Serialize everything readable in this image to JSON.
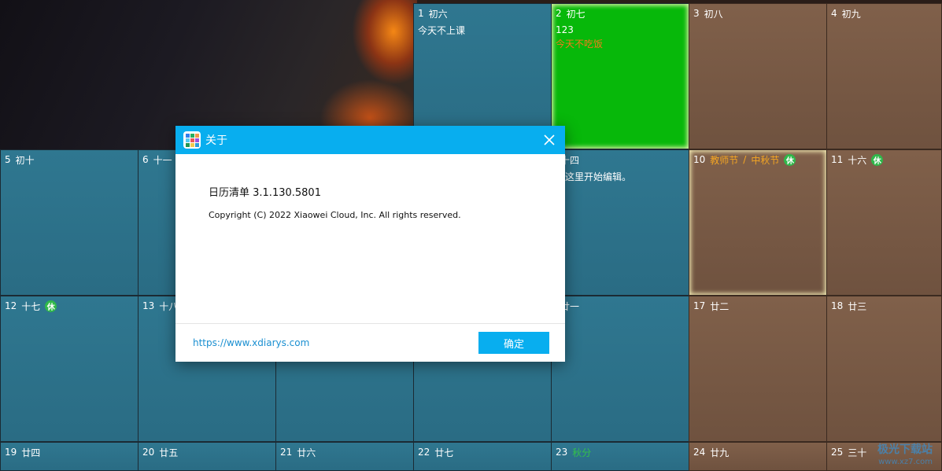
{
  "calendar": {
    "cells": [
      {
        "day": "1",
        "lunar": "初六",
        "note": "今天不上课",
        "style": "blue"
      },
      {
        "day": "2",
        "lunar": "初七",
        "note": "123",
        "note2": "今天不吃饭",
        "style": "green"
      },
      {
        "day": "3",
        "lunar": "初八",
        "style": "brown"
      },
      {
        "day": "4",
        "lunar": "初九",
        "style": "brown"
      },
      {
        "day": "5",
        "lunar": "初十",
        "style": "blue"
      },
      {
        "day": "6",
        "lunar": "十一",
        "style": "blue"
      },
      {
        "day": "",
        "lunar": "十四",
        "note": "击这里开始编辑。",
        "style": "blue"
      },
      {
        "day": "10",
        "lunar": "教师节",
        "sep": "/",
        "lunar2": "中秋节",
        "badge": "休",
        "style": "brown"
      },
      {
        "day": "11",
        "lunar": "十六",
        "badge": "休",
        "style": "brown"
      },
      {
        "day": "12",
        "lunar": "十七",
        "badge": "休",
        "style": "blue"
      },
      {
        "day": "13",
        "lunar": "十八",
        "style": "blue"
      },
      {
        "day": "",
        "lunar": "",
        "style": "blue"
      },
      {
        "day": "",
        "lunar": "",
        "style": "blue"
      },
      {
        "day": "",
        "lunar": "廿一",
        "style": "blue"
      },
      {
        "day": "17",
        "lunar": "廿二",
        "style": "brown"
      },
      {
        "day": "18",
        "lunar": "廿三",
        "style": "brown"
      },
      {
        "day": "19",
        "lunar": "廿四",
        "style": "blue"
      },
      {
        "day": "20",
        "lunar": "廿五",
        "style": "blue"
      },
      {
        "day": "21",
        "lunar": "廿六",
        "style": "blue"
      },
      {
        "day": "22",
        "lunar": "廿七",
        "style": "blue"
      },
      {
        "day": "23",
        "lunar": "秋分",
        "style": "blue"
      },
      {
        "day": "24",
        "lunar": "廿九",
        "style": "brown"
      },
      {
        "day": "25",
        "lunar": "三十",
        "style": "brown"
      }
    ]
  },
  "dialog": {
    "title": "关于",
    "version": "日历清单  3.1.130.5801",
    "copyright": "Copyright (C) 2022 Xiaowei Cloud, Inc. All rights reserved.",
    "link": "https://www.xdiarys.com",
    "ok_label": "确定"
  },
  "watermark": {
    "line1": "极光下载站",
    "line2": "www.xz7.com"
  },
  "colors": {
    "accent": "#08aeef",
    "green_day": "#07b80a",
    "rest_badge": "#2fb84a",
    "festival": "#f5a623"
  }
}
